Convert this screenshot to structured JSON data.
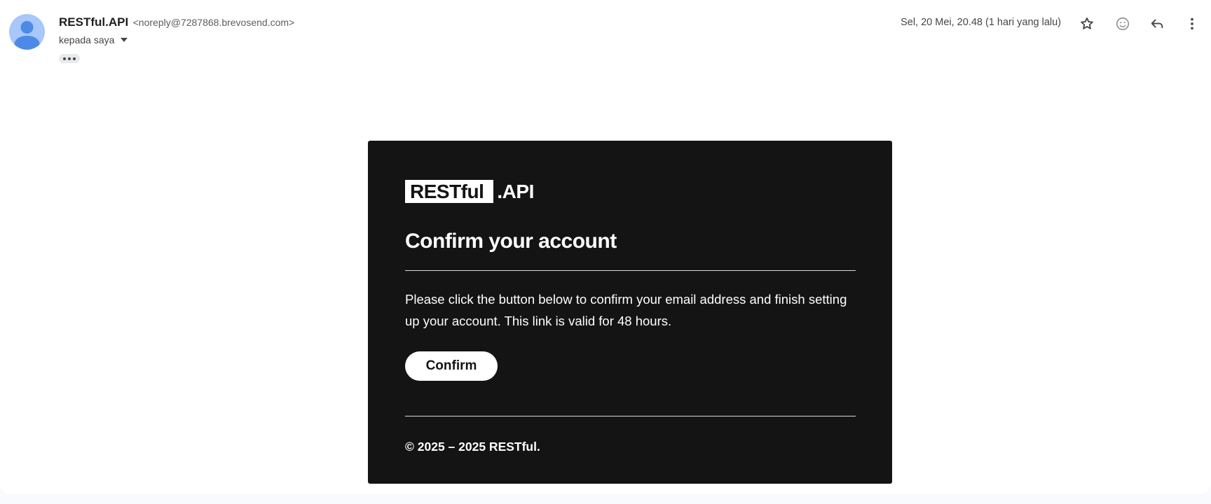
{
  "message_header": {
    "sender_name": "RESTful.API",
    "sender_email": "<noreply@7287868.brevosend.com>",
    "recipient": "kepada saya",
    "date": "Sel, 20 Mei, 20.48 (1 hari yang lalu)",
    "icons": [
      "avatar-person-icon",
      "star-icon",
      "emoji-reaction-icon",
      "reply-icon",
      "more-vert-icon",
      "chevron-down-icon"
    ]
  },
  "email": {
    "logo_main": "RESTful",
    "logo_suffix": ".API",
    "title": "Confirm your account",
    "body": "Please click the button below to confirm your email address and finish setting up your account. This link is valid for 48 hours.",
    "button_label": "Confirm",
    "copyright": "© 2025 – 2025 RESTful."
  },
  "colors": {
    "page_background": "#f8fafd",
    "pane_background": "#ffffff",
    "card_background": "#141414",
    "avatar_background": "#a8c7fa",
    "avatar_figure": "#4d8ae8",
    "card_text": "#ffffff"
  }
}
